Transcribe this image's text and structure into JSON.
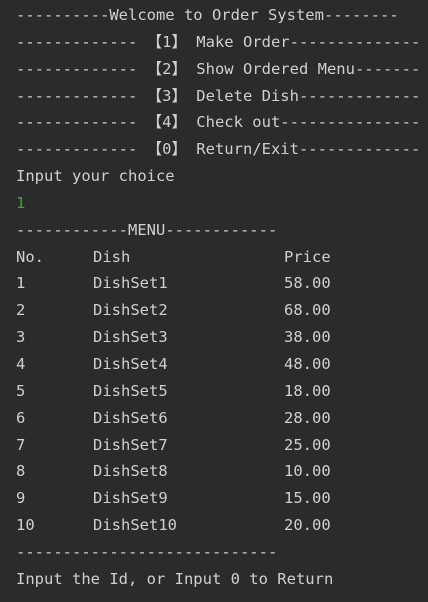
{
  "console": {
    "header": "----------Welcome to Order System--------",
    "menu_options": [
      "------------- 【1】 Make Order--------------",
      "------------- 【2】 Show Ordered Menu-------",
      "------------- 【3】 Delete Dish-------------",
      "------------- 【4】 Check out---------------",
      "------------- 【0】 Return/Exit-------------"
    ],
    "prompt": "Input your choice",
    "user_input": "1",
    "menu_header": "------------MENU------------",
    "table": {
      "columns": [
        "No.",
        "Dish",
        "Price"
      ],
      "rows": [
        {
          "no": "1",
          "dish": "DishSet1",
          "price": "58.00"
        },
        {
          "no": "2",
          "dish": "DishSet2",
          "price": "68.00"
        },
        {
          "no": "3",
          "dish": "DishSet3",
          "price": "38.00"
        },
        {
          "no": "4",
          "dish": "DishSet4",
          "price": "48.00"
        },
        {
          "no": "5",
          "dish": "DishSet5",
          "price": "18.00"
        },
        {
          "no": "6",
          "dish": "DishSet6",
          "price": "28.00"
        },
        {
          "no": "7",
          "dish": "DishSet7",
          "price": "25.00"
        },
        {
          "no": "8",
          "dish": "DishSet8",
          "price": "10.00"
        },
        {
          "no": "9",
          "dish": "DishSet9",
          "price": "15.00"
        },
        {
          "no": "10",
          "dish": "DishSet10",
          "price": "20.00"
        }
      ]
    },
    "menu_footer": "----------------------------",
    "final_prompt": "Input the Id, or Input 0 to Return"
  },
  "colors": {
    "background": "#2b2b2b",
    "text": "#d0d0d0",
    "input": "#3fa43f"
  }
}
